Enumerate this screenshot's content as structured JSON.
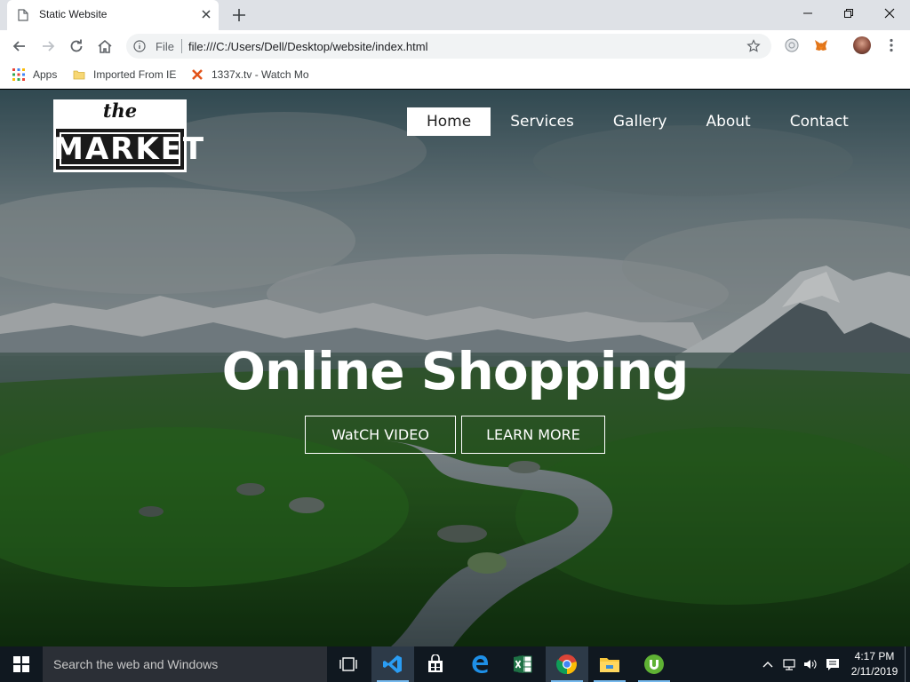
{
  "browser": {
    "tab": {
      "title": "Static Website"
    },
    "omnibox": {
      "scheme_label": "File",
      "url": "file:///C:/Users/Dell/Desktop/website/index.html"
    },
    "bookmarks": [
      {
        "label": "Apps",
        "icon": "apps-grid-icon"
      },
      {
        "label": "Imported From IE",
        "icon": "folder-icon"
      },
      {
        "label": "1337x.tv - Watch Mo",
        "icon": "1337x-favicon-icon"
      }
    ]
  },
  "site": {
    "logo": {
      "the": "the",
      "market": "MARKET"
    },
    "nav": [
      {
        "label": "Home",
        "active": true
      },
      {
        "label": "Services",
        "active": false
      },
      {
        "label": "Gallery",
        "active": false
      },
      {
        "label": "About",
        "active": false
      },
      {
        "label": "Contact",
        "active": false
      }
    ],
    "headline": "Online Shopping",
    "buttons": {
      "watch": "WatCH VIDEO",
      "learn": "LEARN MORE"
    }
  },
  "taskbar": {
    "search_placeholder": "Search the web and Windows",
    "clock": {
      "time": "4:17 PM",
      "date": "2/11/2019"
    },
    "apps": [
      "task-view",
      "visual-studio-code",
      "store",
      "edge",
      "excel",
      "chrome",
      "file-explorer",
      "utorrent"
    ]
  },
  "colors": {
    "taskbar": "#101820",
    "tabstrip": "#dee1e6",
    "nav_active_bg": "#ffffff",
    "accent": "#76b9ed"
  }
}
